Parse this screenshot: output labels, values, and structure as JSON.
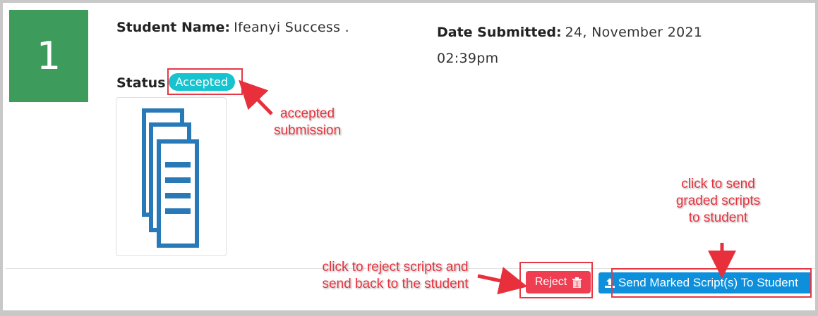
{
  "submission": {
    "number": "1",
    "student_name_label": "Student Name:",
    "student_name": "Ifeanyi Success .",
    "date_label": "Date Submitted:",
    "date_value": "24, November 2021 02:39pm",
    "status_label": "Status",
    "status_badge": "Accepted"
  },
  "actions": {
    "reject_label": "Reject",
    "send_label": "Send Marked Script(s) To Student"
  },
  "annotations": {
    "accepted_note": "accepted submission",
    "reject_note": "click to reject scripts and send back to the student",
    "send_note": "click to send graded scripts to student"
  },
  "icons": {
    "document_icon": "documents-stack-icon",
    "trash_icon": "trash-icon",
    "upload_icon": "upload-icon"
  },
  "colors": {
    "number_box": "#3d9b5b",
    "badge": "#17c3ce",
    "reject": "#ef3e52",
    "send": "#0d8fdc",
    "annotation": "#e8303c"
  }
}
